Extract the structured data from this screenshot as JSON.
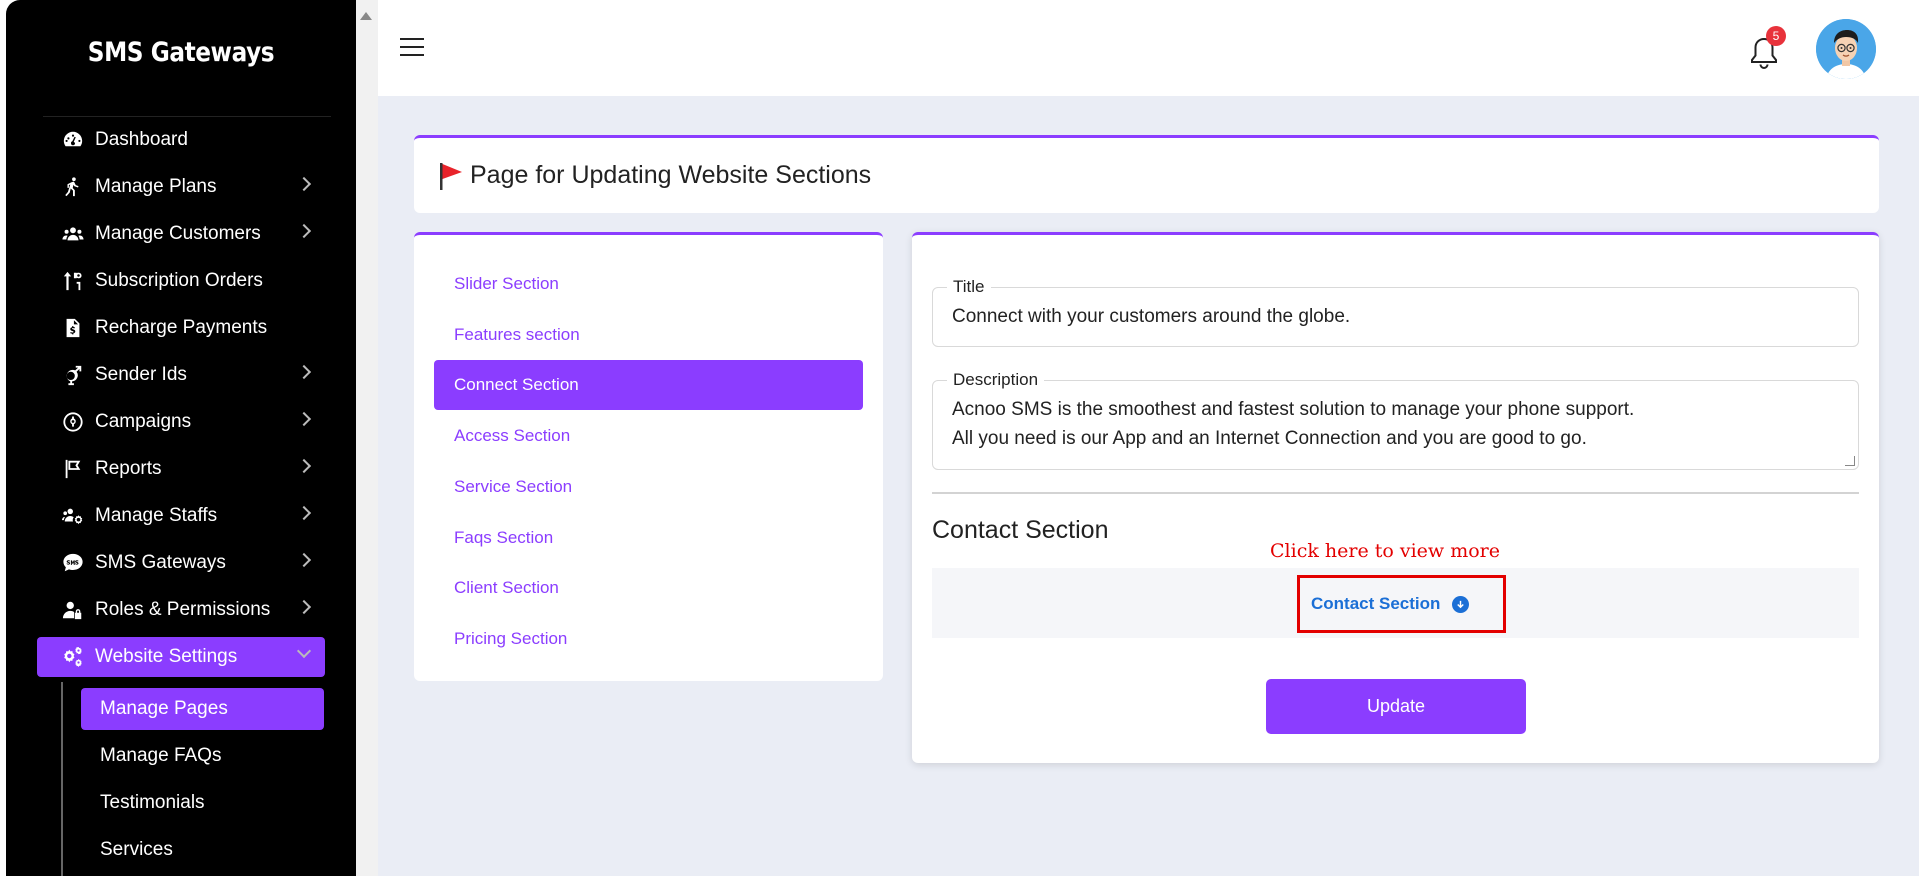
{
  "app": {
    "brand": "SMS Gateways",
    "notification_count": "5"
  },
  "sidebar": {
    "items": [
      {
        "label": "Dashboard",
        "icon": "gauge-icon"
      },
      {
        "label": "Manage Plans",
        "icon": "walking-icon"
      },
      {
        "label": "Manage Customers",
        "icon": "users-icon"
      },
      {
        "label": "Subscription Orders",
        "icon": "sort-icon"
      },
      {
        "label": "Recharge Payments",
        "icon": "invoice-dollar-icon"
      },
      {
        "label": "Sender Ids",
        "icon": "gender-icon"
      },
      {
        "label": "Campaigns",
        "icon": "campaign-icon"
      },
      {
        "label": "Reports",
        "icon": "flag-icon"
      },
      {
        "label": "Manage Staffs",
        "icon": "users-gear-icon"
      },
      {
        "label": "SMS Gateways",
        "icon": "sms-icon"
      },
      {
        "label": "Roles & Permissions",
        "icon": "user-lock-icon"
      },
      {
        "label": "Website Settings",
        "icon": "gears-icon"
      }
    ],
    "submenu": [
      "Manage Pages",
      "Manage FAQs",
      "Testimonials",
      "Services"
    ]
  },
  "page": {
    "title": "Page for Updating Website Sections"
  },
  "sections": [
    "Slider Section",
    "Features section",
    "Connect Section",
    "Access Section",
    "Service Section",
    "Faqs Section",
    "Client Section",
    "Pricing Section"
  ],
  "form": {
    "title_label": "Title",
    "title_value": "Connect with your customers around the globe.",
    "description_label": "Description",
    "description_value": "Acnoo SMS is the smoothest and fastest solution to manage your phone support.\nAll you need is our App and an Internet Connection and you are good to go.",
    "contact_heading": "Contact Section",
    "hint": "Click here to view more",
    "accordion_label": "Contact Section",
    "update_label": "Update"
  },
  "colors": {
    "accent": "#8b3dff",
    "link_blue": "#1b6fd6",
    "hint_red": "#e30000",
    "badge_red": "#e8323b"
  }
}
